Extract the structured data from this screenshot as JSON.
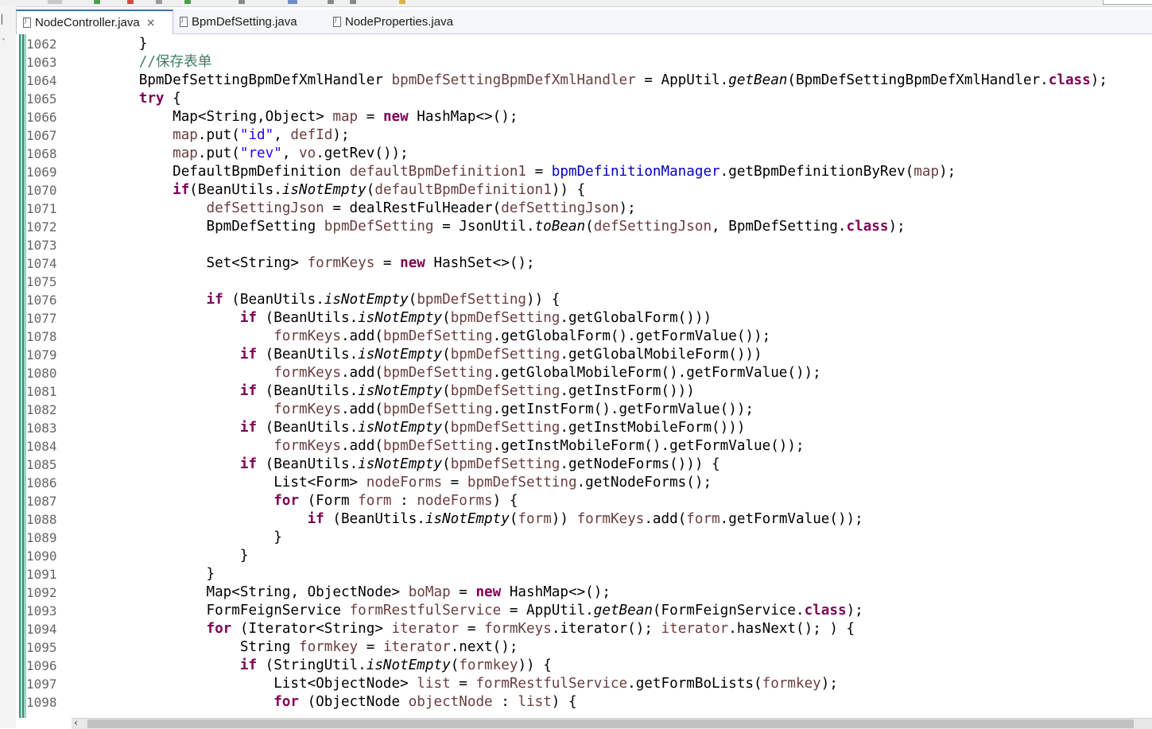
{
  "tabs": [
    {
      "label": "NodeController.java",
      "active": true,
      "close_symbol": "×"
    },
    {
      "label": "BpmDefSetting.java",
      "active": false
    },
    {
      "label": "NodeProperties.java",
      "active": false
    }
  ],
  "colors": {
    "keyword": "#7f0055",
    "local_variable": "#6a3e3e",
    "field": "#0000c0",
    "string": "#2a00ff",
    "comment": "#3f7f5f",
    "line_number": "#666666"
  },
  "editor": {
    "lines": [
      {
        "num": "1062",
        "tokens": [
          [
            "        }",
            ""
          ]
        ]
      },
      {
        "num": "1063",
        "tokens": [
          [
            "        //保存表单",
            "cm"
          ]
        ]
      },
      {
        "num": "1064",
        "tokens": [
          [
            "        BpmDefSettingBpmDefXmlHandler ",
            ""
          ],
          [
            "bpmDefSettingBpmDefXmlHandler",
            "fd"
          ],
          [
            " = AppUtil.",
            ""
          ],
          [
            "getBean",
            "it"
          ],
          [
            "(BpmDefSettingBpmDefXmlHandler.",
            ""
          ],
          [
            "class",
            "kw"
          ],
          [
            ");",
            ""
          ]
        ]
      },
      {
        "num": "1065",
        "tokens": [
          [
            "        ",
            ""
          ],
          [
            "try",
            "kw"
          ],
          [
            " {",
            ""
          ]
        ]
      },
      {
        "num": "1066",
        "tokens": [
          [
            "            Map<String,Object> ",
            ""
          ],
          [
            "map",
            "fd"
          ],
          [
            " = ",
            ""
          ],
          [
            "new",
            "kw"
          ],
          [
            " HashMap<>();",
            ""
          ]
        ]
      },
      {
        "num": "1067",
        "tokens": [
          [
            "            ",
            ""
          ],
          [
            "map",
            "fd"
          ],
          [
            ".put(",
            ""
          ],
          [
            "\"id\"",
            "st"
          ],
          [
            ", ",
            ""
          ],
          [
            "defId",
            "fd"
          ],
          [
            ");",
            ""
          ]
        ]
      },
      {
        "num": "1068",
        "tokens": [
          [
            "            ",
            ""
          ],
          [
            "map",
            "fd"
          ],
          [
            ".put(",
            ""
          ],
          [
            "\"rev\"",
            "st"
          ],
          [
            ", ",
            ""
          ],
          [
            "vo",
            "fd"
          ],
          [
            ".getRev());",
            ""
          ]
        ]
      },
      {
        "num": "1069",
        "tokens": [
          [
            "            DefaultBpmDefinition ",
            ""
          ],
          [
            "defaultBpmDefinition1",
            "fd"
          ],
          [
            " = ",
            ""
          ],
          [
            "bpmDefinitionManager",
            "fi"
          ],
          [
            ".getBpmDefinitionByRev(",
            ""
          ],
          [
            "map",
            "fd"
          ],
          [
            ");",
            ""
          ]
        ]
      },
      {
        "num": "1070",
        "tokens": [
          [
            "            ",
            ""
          ],
          [
            "if",
            "kw"
          ],
          [
            "(BeanUtils.",
            ""
          ],
          [
            "isNotEmpty",
            "it"
          ],
          [
            "(",
            ""
          ],
          [
            "defaultBpmDefinition1",
            "fd"
          ],
          [
            ")) {",
            ""
          ]
        ]
      },
      {
        "num": "1071",
        "tokens": [
          [
            "                ",
            ""
          ],
          [
            "defSettingJson",
            "fd"
          ],
          [
            " = dealRestFulHeader(",
            ""
          ],
          [
            "defSettingJson",
            "fd"
          ],
          [
            ");",
            ""
          ]
        ]
      },
      {
        "num": "1072",
        "tokens": [
          [
            "                BpmDefSetting ",
            ""
          ],
          [
            "bpmDefSetting",
            "fd"
          ],
          [
            " = JsonUtil.",
            ""
          ],
          [
            "toBean",
            "it"
          ],
          [
            "(",
            ""
          ],
          [
            "defSettingJson",
            "fd"
          ],
          [
            ", BpmDefSetting.",
            ""
          ],
          [
            "class",
            "kw"
          ],
          [
            ");",
            ""
          ]
        ]
      },
      {
        "num": "1073",
        "tokens": [
          [
            "",
            ""
          ]
        ]
      },
      {
        "num": "1074",
        "tokens": [
          [
            "                Set<String> ",
            ""
          ],
          [
            "formKeys",
            "fd"
          ],
          [
            " = ",
            ""
          ],
          [
            "new",
            "kw"
          ],
          [
            " HashSet<>();",
            ""
          ]
        ]
      },
      {
        "num": "1075",
        "tokens": [
          [
            "",
            ""
          ]
        ]
      },
      {
        "num": "1076",
        "tokens": [
          [
            "                ",
            ""
          ],
          [
            "if",
            "kw"
          ],
          [
            " (BeanUtils.",
            ""
          ],
          [
            "isNotEmpty",
            "it"
          ],
          [
            "(",
            ""
          ],
          [
            "bpmDefSetting",
            "fd"
          ],
          [
            ")) {",
            ""
          ]
        ]
      },
      {
        "num": "1077",
        "tokens": [
          [
            "                    ",
            ""
          ],
          [
            "if",
            "kw"
          ],
          [
            " (BeanUtils.",
            ""
          ],
          [
            "isNotEmpty",
            "it"
          ],
          [
            "(",
            ""
          ],
          [
            "bpmDefSetting",
            "fd"
          ],
          [
            ".getGlobalForm()))",
            ""
          ]
        ]
      },
      {
        "num": "1078",
        "tokens": [
          [
            "                        ",
            ""
          ],
          [
            "formKeys",
            "fd"
          ],
          [
            ".add(",
            ""
          ],
          [
            "bpmDefSetting",
            "fd"
          ],
          [
            ".getGlobalForm().getFormValue());",
            ""
          ]
        ]
      },
      {
        "num": "1079",
        "tokens": [
          [
            "                    ",
            ""
          ],
          [
            "if",
            "kw"
          ],
          [
            " (BeanUtils.",
            ""
          ],
          [
            "isNotEmpty",
            "it"
          ],
          [
            "(",
            ""
          ],
          [
            "bpmDefSetting",
            "fd"
          ],
          [
            ".getGlobalMobileForm()))",
            ""
          ]
        ]
      },
      {
        "num": "1080",
        "tokens": [
          [
            "                        ",
            ""
          ],
          [
            "formKeys",
            "fd"
          ],
          [
            ".add(",
            ""
          ],
          [
            "bpmDefSetting",
            "fd"
          ],
          [
            ".getGlobalMobileForm().getFormValue());",
            ""
          ]
        ]
      },
      {
        "num": "1081",
        "tokens": [
          [
            "                    ",
            ""
          ],
          [
            "if",
            "kw"
          ],
          [
            " (BeanUtils.",
            ""
          ],
          [
            "isNotEmpty",
            "it"
          ],
          [
            "(",
            ""
          ],
          [
            "bpmDefSetting",
            "fd"
          ],
          [
            ".getInstForm()))",
            ""
          ]
        ]
      },
      {
        "num": "1082",
        "tokens": [
          [
            "                        ",
            ""
          ],
          [
            "formKeys",
            "fd"
          ],
          [
            ".add(",
            ""
          ],
          [
            "bpmDefSetting",
            "fd"
          ],
          [
            ".getInstForm().getFormValue());",
            ""
          ]
        ]
      },
      {
        "num": "1083",
        "tokens": [
          [
            "                    ",
            ""
          ],
          [
            "if",
            "kw"
          ],
          [
            " (BeanUtils.",
            ""
          ],
          [
            "isNotEmpty",
            "it"
          ],
          [
            "(",
            ""
          ],
          [
            "bpmDefSetting",
            "fd"
          ],
          [
            ".getInstMobileForm()))",
            ""
          ]
        ]
      },
      {
        "num": "1084",
        "tokens": [
          [
            "                        ",
            ""
          ],
          [
            "formKeys",
            "fd"
          ],
          [
            ".add(",
            ""
          ],
          [
            "bpmDefSetting",
            "fd"
          ],
          [
            ".getInstMobileForm().getFormValue());",
            ""
          ]
        ]
      },
      {
        "num": "1085",
        "tokens": [
          [
            "                    ",
            ""
          ],
          [
            "if",
            "kw"
          ],
          [
            " (BeanUtils.",
            ""
          ],
          [
            "isNotEmpty",
            "it"
          ],
          [
            "(",
            ""
          ],
          [
            "bpmDefSetting",
            "fd"
          ],
          [
            ".getNodeForms())) {",
            ""
          ]
        ]
      },
      {
        "num": "1086",
        "tokens": [
          [
            "                        List<Form> ",
            ""
          ],
          [
            "nodeForms",
            "fd"
          ],
          [
            " = ",
            ""
          ],
          [
            "bpmDefSetting",
            "fd"
          ],
          [
            ".getNodeForms();",
            ""
          ]
        ]
      },
      {
        "num": "1087",
        "tokens": [
          [
            "                        ",
            ""
          ],
          [
            "for",
            "kw"
          ],
          [
            " (Form ",
            ""
          ],
          [
            "form",
            "fd"
          ],
          [
            " : ",
            ""
          ],
          [
            "nodeForms",
            "fd"
          ],
          [
            ") {",
            ""
          ]
        ]
      },
      {
        "num": "1088",
        "tokens": [
          [
            "                            ",
            ""
          ],
          [
            "if",
            "kw"
          ],
          [
            " (BeanUtils.",
            ""
          ],
          [
            "isNotEmpty",
            "it"
          ],
          [
            "(",
            ""
          ],
          [
            "form",
            "fd"
          ],
          [
            ")) ",
            ""
          ],
          [
            "formKeys",
            "fd"
          ],
          [
            ".add(",
            ""
          ],
          [
            "form",
            "fd"
          ],
          [
            ".getFormValue());",
            ""
          ]
        ]
      },
      {
        "num": "1089",
        "tokens": [
          [
            "                        }",
            ""
          ]
        ]
      },
      {
        "num": "1090",
        "tokens": [
          [
            "                    }",
            ""
          ]
        ]
      },
      {
        "num": "1091",
        "tokens": [
          [
            "                }",
            ""
          ]
        ]
      },
      {
        "num": "1092",
        "tokens": [
          [
            "                Map<String, ObjectNode> ",
            ""
          ],
          [
            "boMap",
            "fd"
          ],
          [
            " = ",
            ""
          ],
          [
            "new",
            "kw"
          ],
          [
            " HashMap<>();",
            ""
          ]
        ]
      },
      {
        "num": "1093",
        "tokens": [
          [
            "                FormFeignService ",
            ""
          ],
          [
            "formRestfulService",
            "fd"
          ],
          [
            " = AppUtil.",
            ""
          ],
          [
            "getBean",
            "it"
          ],
          [
            "(FormFeignService.",
            ""
          ],
          [
            "class",
            "kw"
          ],
          [
            ");",
            ""
          ]
        ]
      },
      {
        "num": "1094",
        "tokens": [
          [
            "                ",
            ""
          ],
          [
            "for",
            "kw"
          ],
          [
            " (Iterator<String> ",
            ""
          ],
          [
            "iterator",
            "fd"
          ],
          [
            " = ",
            ""
          ],
          [
            "formKeys",
            "fd"
          ],
          [
            ".iterator(); ",
            ""
          ],
          [
            "iterator",
            "fd"
          ],
          [
            ".hasNext(); ) {",
            ""
          ]
        ]
      },
      {
        "num": "1095",
        "tokens": [
          [
            "                    String ",
            ""
          ],
          [
            "formkey",
            "fd"
          ],
          [
            " = ",
            ""
          ],
          [
            "iterator",
            "fd"
          ],
          [
            ".next();",
            ""
          ]
        ]
      },
      {
        "num": "1096",
        "tokens": [
          [
            "                    ",
            ""
          ],
          [
            "if",
            "kw"
          ],
          [
            " (StringUtil.",
            ""
          ],
          [
            "isNotEmpty",
            "it"
          ],
          [
            "(",
            ""
          ],
          [
            "formkey",
            "fd"
          ],
          [
            ")) {",
            ""
          ]
        ]
      },
      {
        "num": "1097",
        "tokens": [
          [
            "                        List<ObjectNode> ",
            ""
          ],
          [
            "list",
            "fd"
          ],
          [
            " = ",
            ""
          ],
          [
            "formRestfulService",
            "fd"
          ],
          [
            ".getFormBoLists(",
            ""
          ],
          [
            "formkey",
            "fd"
          ],
          [
            ");",
            ""
          ]
        ]
      },
      {
        "num": "1098",
        "tokens": [
          [
            "                        ",
            ""
          ],
          [
            "for",
            "kw"
          ],
          [
            " (ObjectNode ",
            ""
          ],
          [
            "objectNode",
            "fd"
          ],
          [
            " : ",
            ""
          ],
          [
            "list",
            "fd"
          ],
          [
            ") {",
            ""
          ]
        ]
      }
    ]
  },
  "scrollbar": {
    "left_arrow": "‹"
  }
}
